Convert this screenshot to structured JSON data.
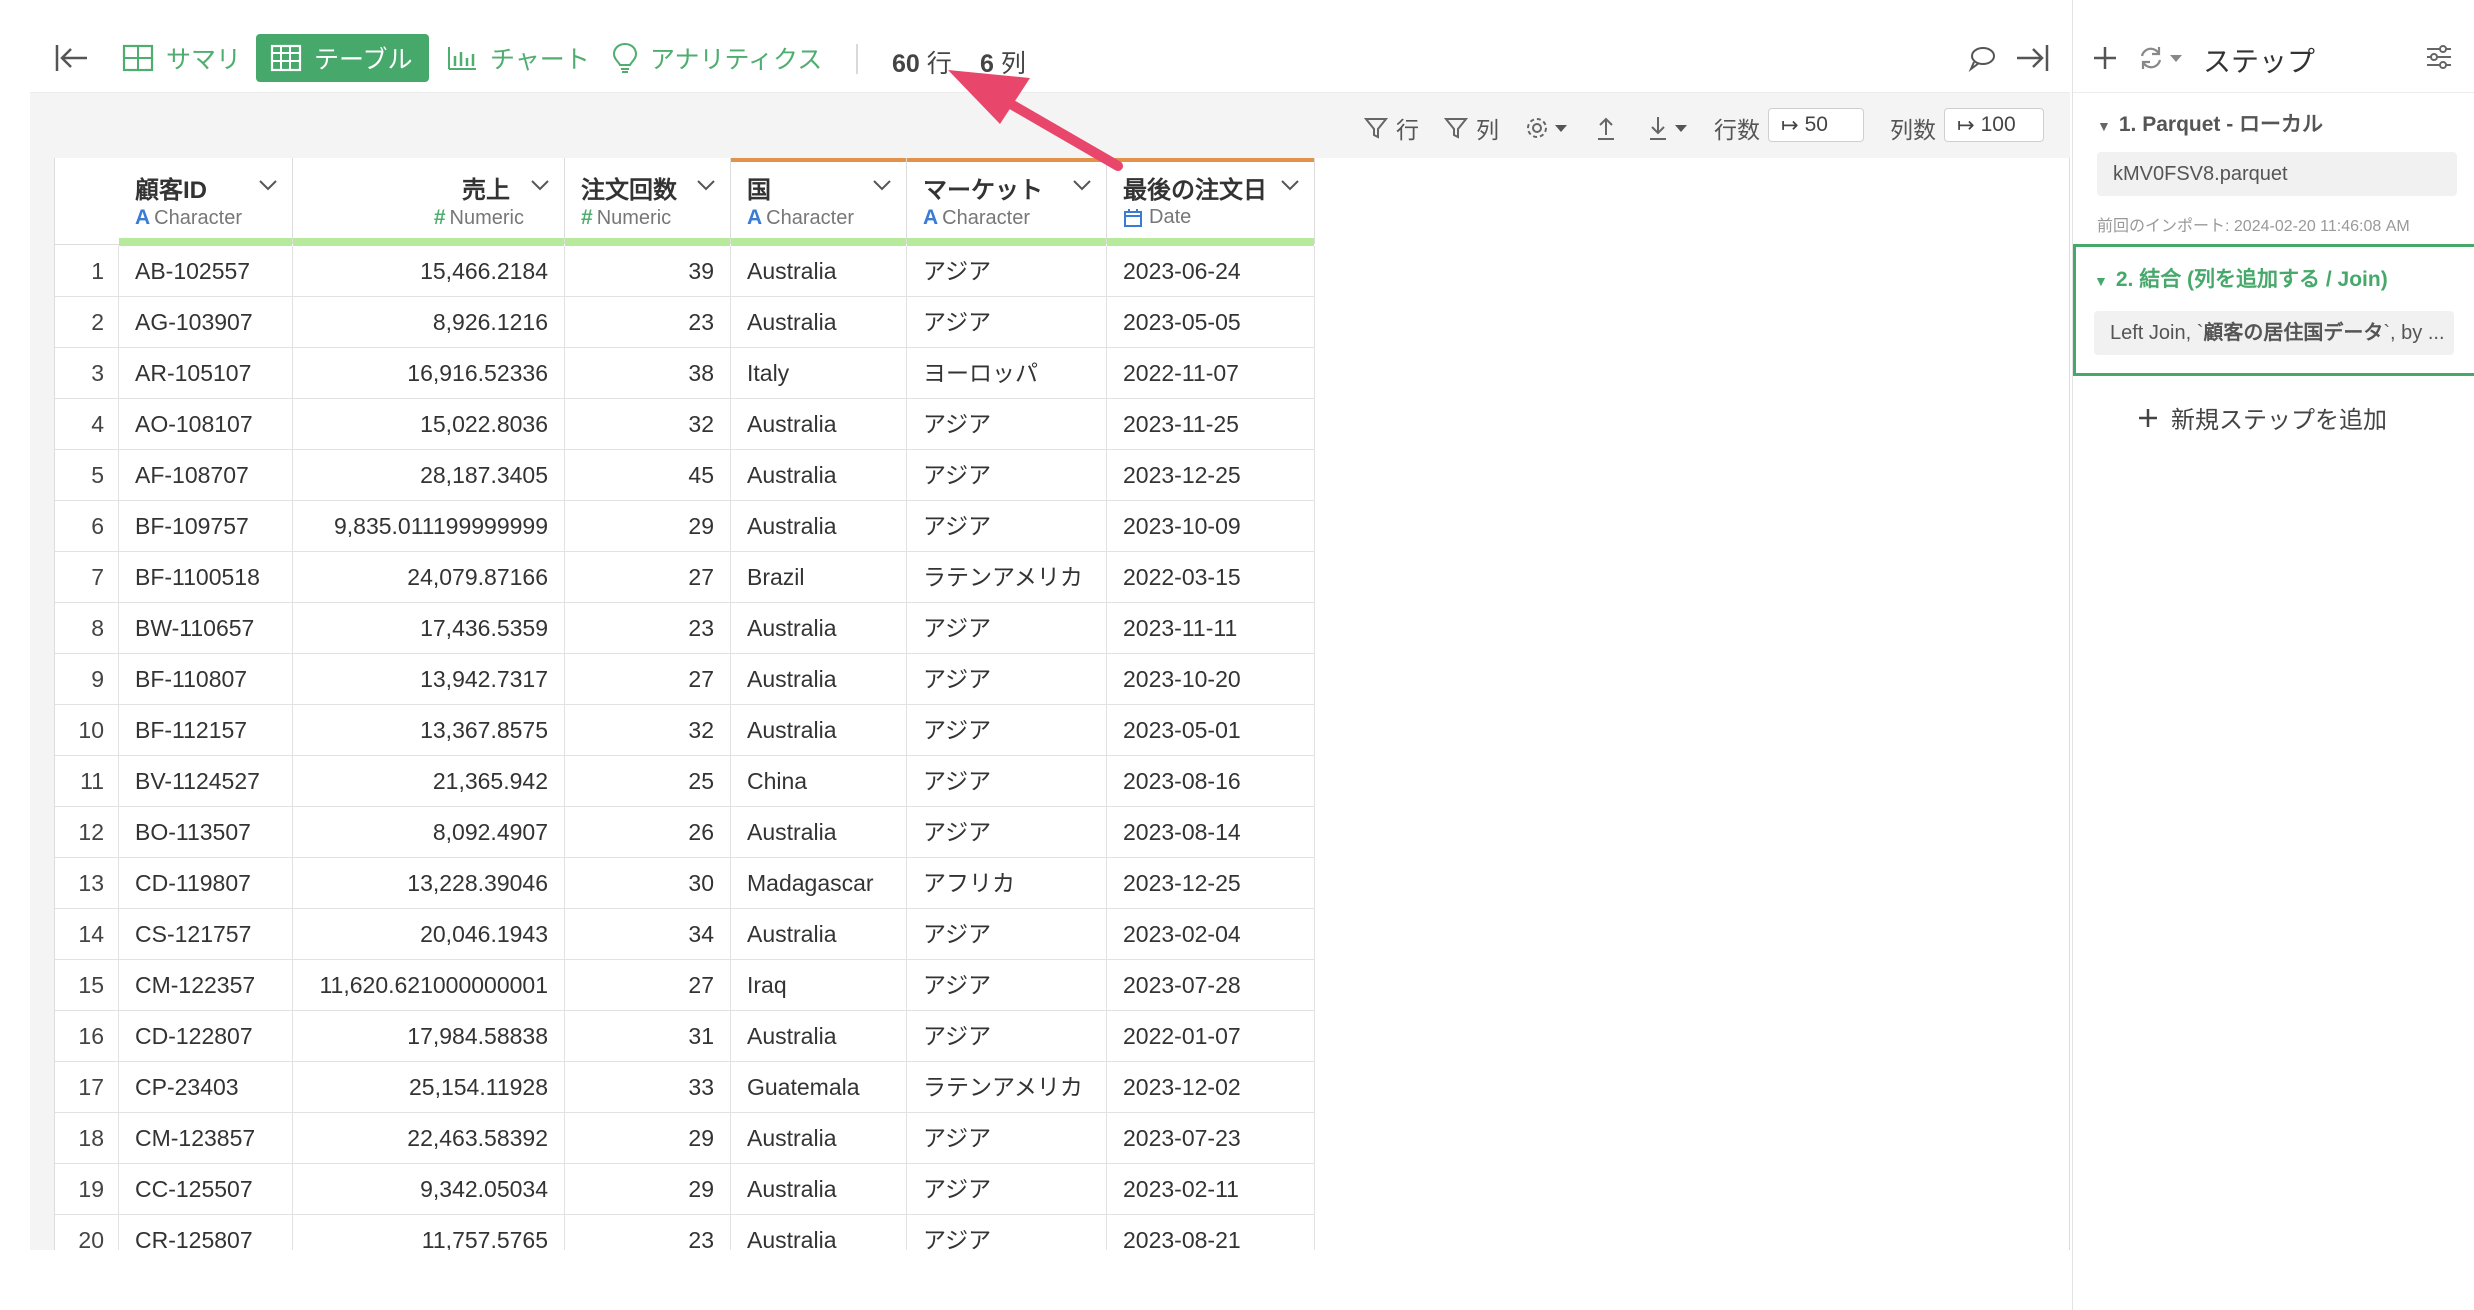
{
  "toolbar": {
    "summary_label": "サマリ",
    "table_label": "テーブル",
    "chart_label": "チャート",
    "analytics_label": "アナリティクス",
    "rows_count": "60",
    "rows_unit": "行",
    "cols_count": "6",
    "cols_unit": "列"
  },
  "controls": {
    "row_filter": "行",
    "col_filter": "列",
    "rows_label": "行数",
    "rows_value": "50",
    "cols_label": "列数",
    "cols_value": "100"
  },
  "columns": [
    {
      "name": "顧客ID",
      "type": "Character",
      "type_icon": "A"
    },
    {
      "name": "売上",
      "type": "Numeric",
      "type_icon": "#"
    },
    {
      "name": "注文回数",
      "type": "Numeric",
      "type_icon": "#"
    },
    {
      "name": "国",
      "type": "Character",
      "type_icon": "A"
    },
    {
      "name": "マーケット",
      "type": "Character",
      "type_icon": "A"
    },
    {
      "name": "最後の注文日",
      "type": "Date",
      "type_icon": "calendar-icon"
    }
  ],
  "rows": [
    [
      "1",
      "AB-102557",
      "15,466.2184",
      "39",
      "Australia",
      "アジア",
      "2023-06-24"
    ],
    [
      "2",
      "AG-103907",
      "8,926.1216",
      "23",
      "Australia",
      "アジア",
      "2023-05-05"
    ],
    [
      "3",
      "AR-105107",
      "16,916.52336",
      "38",
      "Italy",
      "ヨーロッパ",
      "2022-11-07"
    ],
    [
      "4",
      "AO-108107",
      "15,022.8036",
      "32",
      "Australia",
      "アジア",
      "2023-11-25"
    ],
    [
      "5",
      "AF-108707",
      "28,187.3405",
      "45",
      "Australia",
      "アジア",
      "2023-12-25"
    ],
    [
      "6",
      "BF-109757",
      "9,835.011199999999",
      "29",
      "Australia",
      "アジア",
      "2023-10-09"
    ],
    [
      "7",
      "BF-1100518",
      "24,079.87166",
      "27",
      "Brazil",
      "ラテンアメリカ",
      "2022-03-15"
    ],
    [
      "8",
      "BW-110657",
      "17,436.5359",
      "23",
      "Australia",
      "アジア",
      "2023-11-11"
    ],
    [
      "9",
      "BF-110807",
      "13,942.7317",
      "27",
      "Australia",
      "アジア",
      "2023-10-20"
    ],
    [
      "10",
      "BF-112157",
      "13,367.8575",
      "32",
      "Australia",
      "アジア",
      "2023-05-01"
    ],
    [
      "11",
      "BV-1124527",
      "21,365.942",
      "25",
      "China",
      "アジア",
      "2023-08-16"
    ],
    [
      "12",
      "BO-113507",
      "8,092.4907",
      "26",
      "Australia",
      "アジア",
      "2023-08-14"
    ],
    [
      "13",
      "CD-119807",
      "13,228.39046",
      "30",
      "Madagascar",
      "アフリカ",
      "2023-12-25"
    ],
    [
      "14",
      "CS-121757",
      "20,046.1943",
      "34",
      "Australia",
      "アジア",
      "2023-02-04"
    ],
    [
      "15",
      "CM-122357",
      "11,620.621000000001",
      "27",
      "Iraq",
      "アジア",
      "2023-07-28"
    ],
    [
      "16",
      "CD-122807",
      "17,984.58838",
      "31",
      "Australia",
      "アジア",
      "2022-01-07"
    ],
    [
      "17",
      "CP-23403",
      "25,154.11928",
      "33",
      "Guatemala",
      "ラテンアメリカ",
      "2023-12-02"
    ],
    [
      "18",
      "CM-123857",
      "22,463.58392",
      "29",
      "Australia",
      "アジア",
      "2023-07-23"
    ],
    [
      "19",
      "CC-125507",
      "9,342.05034",
      "29",
      "Australia",
      "アジア",
      "2023-02-11"
    ],
    [
      "20",
      "CR-125807",
      "11,757.5765",
      "23",
      "Australia",
      "アジア",
      "2023-08-21"
    ]
  ],
  "sidebar": {
    "title": "ステップ",
    "step1_title": "1. Parquet - ローカル",
    "step1_file": "kMV0FSV8.parquet",
    "step1_meta": "前回のインポート: 2024-02-20 11:46:08 AM",
    "step2_title": "2. 結合 (列を追加する / Join)",
    "step2_desc_pre": "Left Join, `",
    "step2_desc_bold": "顧客の居住国データ",
    "step2_desc_post": "`, by ...",
    "add_step": "新規ステップを追加"
  },
  "colors": {
    "accent": "#46a86a",
    "header_top": "#e3924a",
    "header_bottom": "#b7ea9c",
    "arrow": "#e8466a"
  }
}
